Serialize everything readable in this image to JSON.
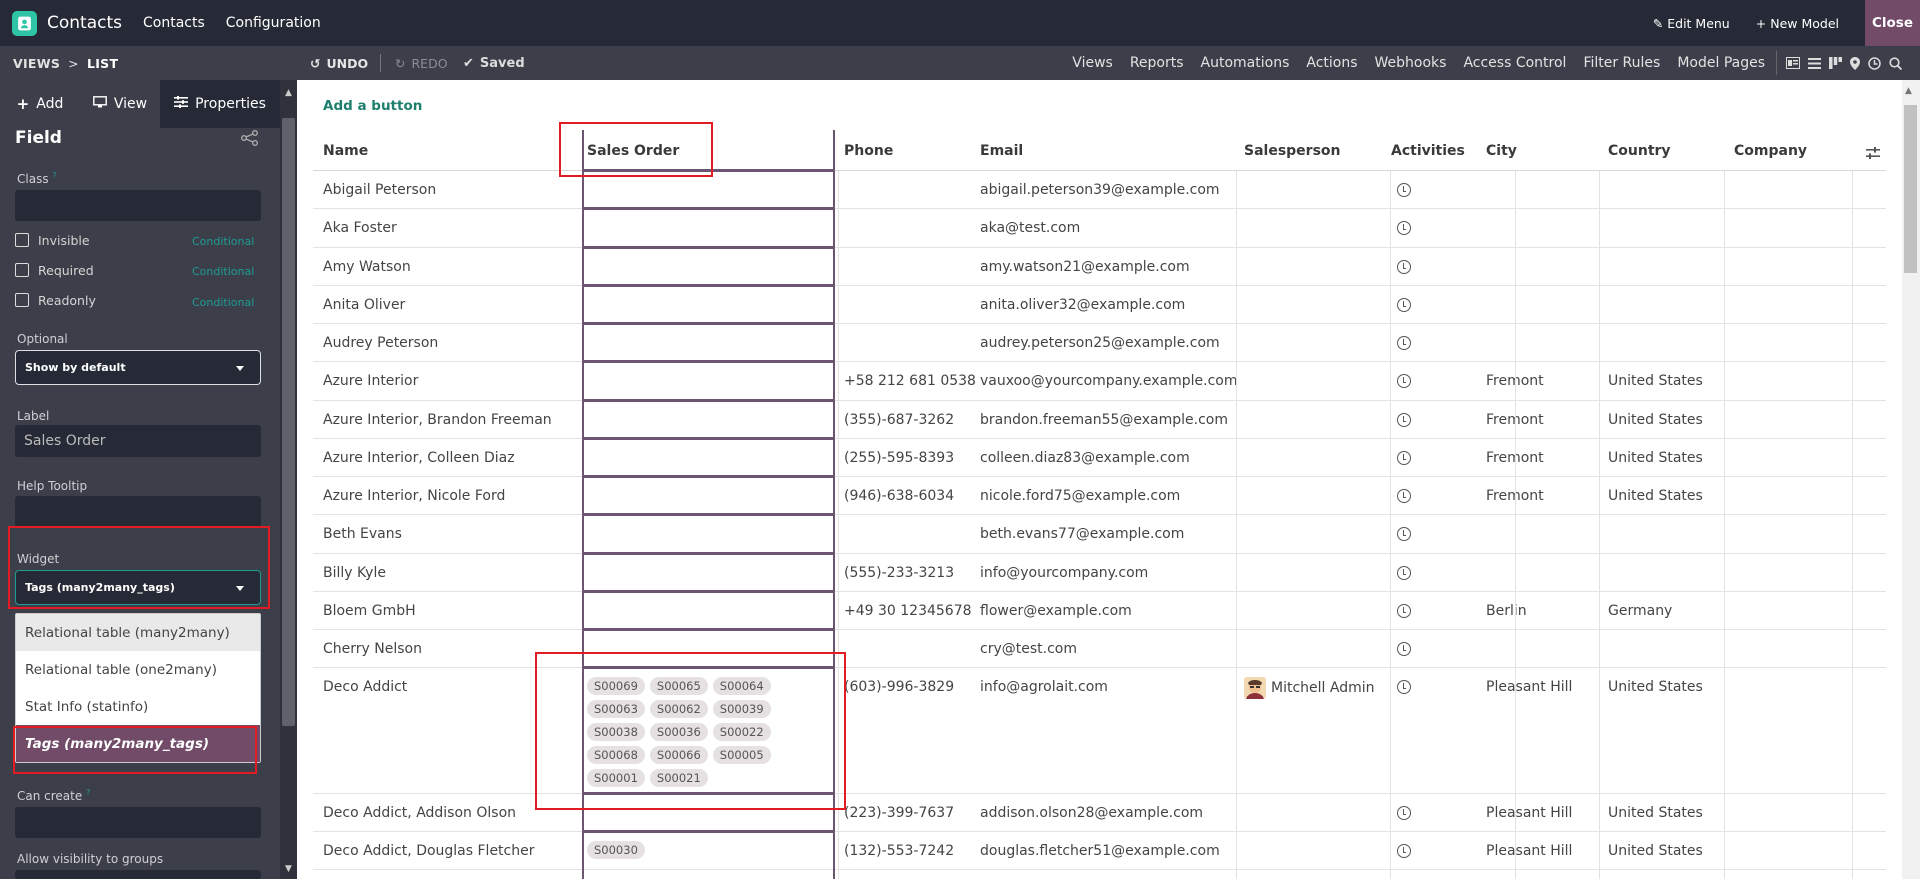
{
  "app": {
    "name": "Contacts",
    "menus": [
      "Contacts",
      "Configuration"
    ]
  },
  "topright": {
    "edit_menu": "Edit Menu",
    "new_model": "New Model",
    "close": "Close"
  },
  "toolbar": {
    "crumb_views": "VIEWS",
    "crumb_sep": ">",
    "crumb_current": "LIST",
    "undo": "UNDO",
    "redo": "REDO",
    "saved": "Saved",
    "menus": [
      "Views",
      "Reports",
      "Automations",
      "Actions",
      "Webhooks",
      "Access Control",
      "Filter Rules",
      "Model Pages"
    ]
  },
  "sidebar": {
    "tabs": [
      "Add",
      "View",
      "Properties"
    ],
    "title": "Field",
    "class_label": "Class",
    "class_tooltip_mark": "?",
    "checkboxes": [
      {
        "label": "Invisible",
        "conditional": "Conditional"
      },
      {
        "label": "Required",
        "conditional": "Conditional"
      },
      {
        "label": "Readonly",
        "conditional": "Conditional"
      }
    ],
    "optional_label": "Optional",
    "optional_value": "Show by default",
    "label_label": "Label",
    "label_value": "Sales Order",
    "help_tooltip_label": "Help Tooltip",
    "widget_label": "Widget",
    "widget_value": "Tags (many2many_tags)",
    "widget_options": [
      "Relational table (many2many)",
      "Relational table (one2many)",
      "Stat Info (statinfo)",
      "Tags (many2many_tags)"
    ],
    "can_create_label": "Can create",
    "can_create_mark": "?",
    "allow_groups_label": "Allow visibility to groups"
  },
  "main": {
    "add_button": "Add a button",
    "columns": [
      "Name",
      "Sales Order",
      "Phone",
      "Email",
      "Salesperson",
      "Activities",
      "City",
      "Country",
      "Company"
    ],
    "rows": [
      {
        "name": "Abigail Peterson",
        "phone": "",
        "email": "abigail.peterson39@example.com",
        "salesperson": "",
        "city": "",
        "country": "",
        "tags": []
      },
      {
        "name": "Aka Foster",
        "phone": "",
        "email": "aka@test.com",
        "salesperson": "",
        "city": "",
        "country": "",
        "tags": []
      },
      {
        "name": "Amy Watson",
        "phone": "",
        "email": "amy.watson21@example.com",
        "salesperson": "",
        "city": "",
        "country": "",
        "tags": []
      },
      {
        "name": "Anita Oliver",
        "phone": "",
        "email": "anita.oliver32@example.com",
        "salesperson": "",
        "city": "",
        "country": "",
        "tags": []
      },
      {
        "name": "Audrey Peterson",
        "phone": "",
        "email": "audrey.peterson25@example.com",
        "salesperson": "",
        "city": "",
        "country": "",
        "tags": []
      },
      {
        "name": "Azure Interior",
        "phone": "+58 212 681 0538",
        "email": "vauxoo@yourcompany.example.com",
        "salesperson": "",
        "city": "Fremont",
        "country": "United States",
        "tags": []
      },
      {
        "name": "Azure Interior, Brandon Freeman",
        "phone": "(355)-687-3262",
        "email": "brandon.freeman55@example.com",
        "salesperson": "",
        "city": "Fremont",
        "country": "United States",
        "tags": []
      },
      {
        "name": "Azure Interior, Colleen Diaz",
        "phone": "(255)-595-8393",
        "email": "colleen.diaz83@example.com",
        "salesperson": "",
        "city": "Fremont",
        "country": "United States",
        "tags": []
      },
      {
        "name": "Azure Interior, Nicole Ford",
        "phone": "(946)-638-6034",
        "email": "nicole.ford75@example.com",
        "salesperson": "",
        "city": "Fremont",
        "country": "United States",
        "tags": []
      },
      {
        "name": "Beth Evans",
        "phone": "",
        "email": "beth.evans77@example.com",
        "salesperson": "",
        "city": "",
        "country": "",
        "tags": []
      },
      {
        "name": "Billy Kyle",
        "phone": "(555)-233-3213",
        "email": "info@yourcompany.com",
        "salesperson": "",
        "city": "",
        "country": "",
        "tags": []
      },
      {
        "name": "Bloem GmbH",
        "phone": "+49 30 12345678",
        "email": "flower@example.com",
        "salesperson": "",
        "city": "Berlin",
        "country": "Germany",
        "tags": []
      },
      {
        "name": "Cherry Nelson",
        "phone": "",
        "email": "cry@test.com",
        "salesperson": "",
        "city": "",
        "country": "",
        "tags": []
      },
      {
        "name": "Deco Addict",
        "phone": "(603)-996-3829",
        "email": "info@agrolait.com",
        "salesperson": "Mitchell Admin",
        "city": "Pleasant Hill",
        "country": "United States",
        "tags": [
          "S00069",
          "S00065",
          "S00064",
          "S00063",
          "S00062",
          "S00039",
          "S00038",
          "S00036",
          "S00022",
          "S00068",
          "S00066",
          "S00005",
          "S00001",
          "S00021"
        ]
      },
      {
        "name": "Deco Addict, Addison Olson",
        "phone": "(223)-399-7637",
        "email": "addison.olson28@example.com",
        "salesperson": "",
        "city": "Pleasant Hill",
        "country": "United States",
        "tags": []
      },
      {
        "name": "Deco Addict, Douglas Fletcher",
        "phone": "(132)-553-7242",
        "email": "douglas.fletcher51@example.com",
        "salesperson": "",
        "city": "Pleasant Hill",
        "country": "United States",
        "tags": [
          "S00030"
        ]
      }
    ]
  },
  "colors": {
    "topbar": "#262a36",
    "toolbar": "#3c3f4a",
    "accent": "#714b67",
    "teal": "#1d9c93",
    "highlight": "#e31b23"
  }
}
